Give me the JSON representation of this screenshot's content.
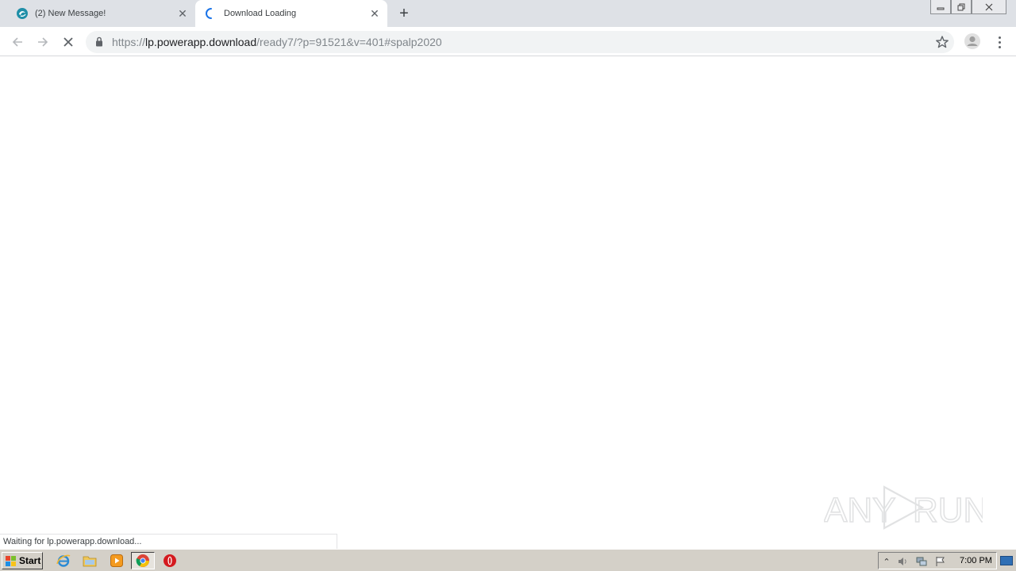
{
  "browser": {
    "tabs": [
      {
        "title": "(2) New Message!",
        "active": false,
        "icon": "swirl-favicon-icon"
      },
      {
        "title": "Download Loading",
        "active": true,
        "icon": "loading-spinner-icon"
      }
    ],
    "new_tab_label": "+",
    "close_glyph": "✕",
    "url": {
      "scheme": "https://",
      "host": "lp.powerapp.download",
      "path": "/ready7/?p=91521&v=401#spalp2020"
    }
  },
  "status_bar": {
    "text": "Waiting for lp.powerapp.download..."
  },
  "watermark": {
    "text_left": "ANY",
    "text_right": "RUN"
  },
  "taskbar": {
    "start_label": "Start",
    "clock": "7:00 PM",
    "tray_arrow": "⌃"
  },
  "colors": {
    "tabstrip": "#dee1e6",
    "omnibox": "#f1f3f4",
    "taskbar": "#d4d0c8",
    "accent_blue": "#1a73e8"
  }
}
